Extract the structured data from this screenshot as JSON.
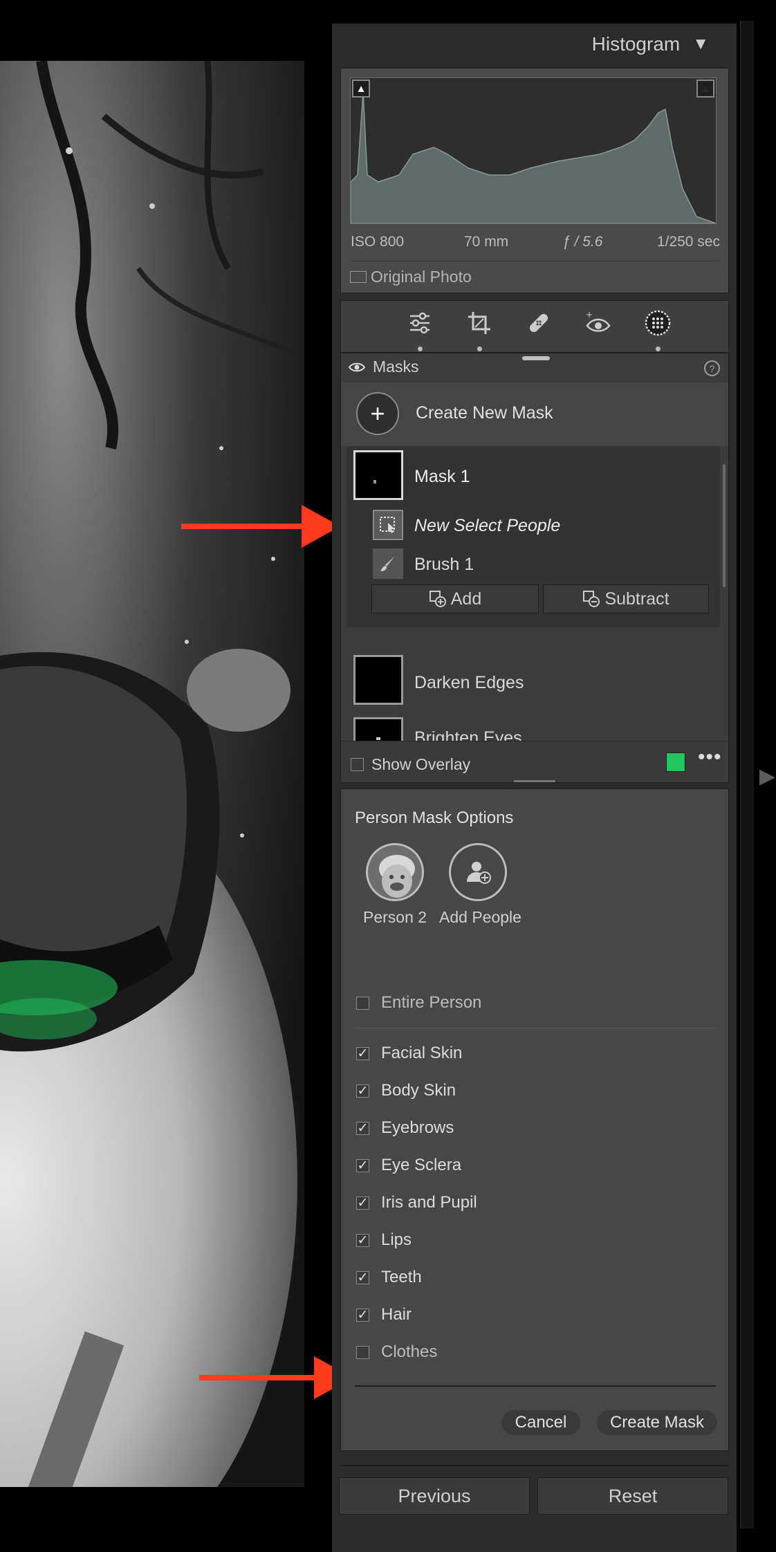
{
  "histogram": {
    "title": "Histogram",
    "collapse_icon": "triangle-down-icon",
    "iso": "ISO 800",
    "focal_length": "70 mm",
    "aperture": "ƒ / 5.6",
    "shutter": "1/250 sec",
    "original_photo_label": "Original Photo"
  },
  "toolstrip": {
    "tools": [
      "edit-sliders-icon",
      "crop-icon",
      "healing-icon",
      "red-eye-icon",
      "masking-icon"
    ]
  },
  "masks": {
    "title": "Masks",
    "create_new_label": "Create New Mask",
    "mask1_name": "Mask 1",
    "select_people_label": "New Select People",
    "brush_label": "Brush 1",
    "add_label": "Add",
    "subtract_label": "Subtract",
    "darken_label": "Darken Edges",
    "brighten_label": "Brighten Eyes",
    "show_overlay_label": "Show Overlay",
    "overlay_color": "#22c55e"
  },
  "person_options": {
    "title": "Person Mask Options",
    "person_label": "Person 2",
    "add_people_label": "Add People",
    "entire_person_label": "Entire Person",
    "items": [
      {
        "label": "Facial Skin",
        "checked": true
      },
      {
        "label": "Body Skin",
        "checked": true
      },
      {
        "label": "Eyebrows",
        "checked": true
      },
      {
        "label": "Eye Sclera",
        "checked": true
      },
      {
        "label": "Iris and Pupil",
        "checked": true
      },
      {
        "label": "Lips",
        "checked": true
      },
      {
        "label": "Teeth",
        "checked": true
      },
      {
        "label": "Hair",
        "checked": true
      },
      {
        "label": "Clothes",
        "checked": false
      }
    ],
    "cancel_label": "Cancel",
    "create_mask_label": "Create Mask"
  },
  "footer": {
    "previous_label": "Previous",
    "reset_label": "Reset"
  },
  "colors": {
    "annotation_arrow": "#ff3a1f",
    "mask_overlay": "#22c55e"
  }
}
